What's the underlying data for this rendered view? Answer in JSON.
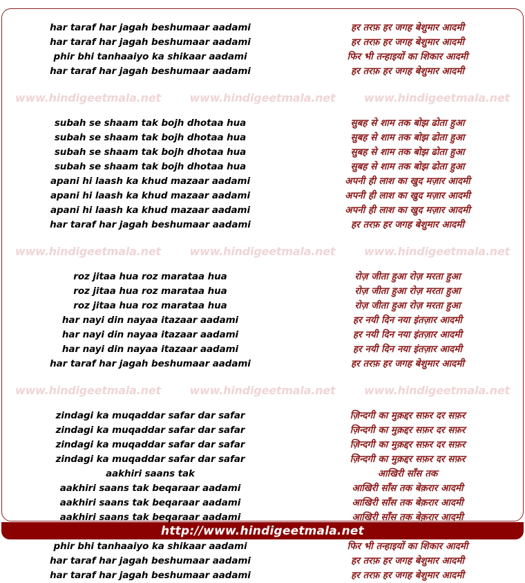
{
  "colors": {
    "latin_text": "#000000",
    "devanagari_text": "#8b1a1a",
    "watermark": "#f0d5d5",
    "footer_background": "#8b0000",
    "footer_text": "#ffffff",
    "frame_border": "#8b2020",
    "page_background": "#ffffff"
  },
  "watermark": {
    "text": "www.hindigeetmala.net",
    "repeats": 3
  },
  "footer": {
    "url": "http://www.hindigeetmala.net"
  },
  "blocks": [
    {
      "lines": [
        {
          "latin": "har taraf har jagah beshumaar aadami",
          "deva": "हर तरफ़ हर जगह बेशुमार आदमी"
        },
        {
          "latin": "har taraf har jagah beshumaar aadami",
          "deva": "हर तरफ़ हर जगह बेशुमार आदमी"
        },
        {
          "latin": "phir bhi tanhaaiyo ka shikaar aadami",
          "deva": "फिर भी तन्हाइयों का शिकार आदमी"
        },
        {
          "latin": "har taraf har jagah beshumaar aadami",
          "deva": "हर तरफ़ हर जगह बेशुमार आदमी"
        }
      ]
    },
    {
      "lines": [
        {
          "latin": "subah se shaam tak bojh dhotaa hua",
          "deva": "सुबह से शाम तक बोझ ढोता हुआ"
        },
        {
          "latin": "subah se shaam tak bojh dhotaa hua",
          "deva": "सुबह से शाम तक बोझ ढोता हुआ"
        },
        {
          "latin": "subah se shaam tak bojh dhotaa hua",
          "deva": "सुबह से शाम तक बोझ ढोता हुआ"
        },
        {
          "latin": "subah se shaam tak bojh dhotaa hua",
          "deva": "सुबह से शाम तक बोझ ढोता हुआ"
        },
        {
          "latin": "apani hi laash ka khud mazaar aadami",
          "deva": "अपनी ही लाश का खुद मज़ार आदमी"
        },
        {
          "latin": "apani hi laash ka khud mazaar aadami",
          "deva": "अपनी ही लाश का खुद मज़ार आदमी"
        },
        {
          "latin": "apani hi laash ka khud mazaar aadami",
          "deva": "अपनी ही लाश का खुद मज़ार आदमी"
        },
        {
          "latin": "har taraf har jagah beshumaar aadami",
          "deva": "हर तरफ़ हर जगह बेशुमार आदमी"
        }
      ]
    },
    {
      "lines": [
        {
          "latin": "roz jitaa hua roz marataa hua",
          "deva": "रोज़ जीता हुआ रोज़ मरता हुआ"
        },
        {
          "latin": "roz jitaa hua roz marataa hua",
          "deva": "रोज़ जीता हुआ रोज़ मरता हुआ"
        },
        {
          "latin": "roz jitaa hua roz marataa hua",
          "deva": "रोज़ जीता हुआ रोज़ मरता हुआ"
        },
        {
          "latin": "har nayi din nayaa itazaar aadami",
          "deva": "हर नयी दिन नया इंतज़ार आदमी"
        },
        {
          "latin": "har nayi din nayaa itazaar aadami",
          "deva": "हर नयी दिन नया इंतज़ार आदमी"
        },
        {
          "latin": "har nayi din nayaa itazaar aadami",
          "deva": "हर नयी दिन नया इंतज़ार आदमी"
        },
        {
          "latin": "har taraf har jagah beshumaar aadami",
          "deva": "हर तरफ़ हर जगह बेशुमार आदमी"
        }
      ]
    },
    {
      "lines": [
        {
          "latin": "zindagi ka muqaddar safar dar safar",
          "deva": "ज़िन्दगी का मुक़द्दर सफ़र दर सफ़र"
        },
        {
          "latin": "zindagi ka muqaddar safar dar safar",
          "deva": "ज़िन्दगी का मुक़द्दर सफ़र दर सफ़र"
        },
        {
          "latin": "zindagi ka muqaddar safar dar safar",
          "deva": "ज़िन्दगी का मुक़द्दर सफ़र दर सफ़र"
        },
        {
          "latin": "zindagi ka muqaddar safar dar safar",
          "deva": "ज़िन्दगी का मुक़द्दर सफ़र दर सफ़र"
        },
        {
          "latin": "aakhiri saans tak",
          "deva": "आखिरी साँस तक"
        },
        {
          "latin": "aakhiri saans tak beqaraar aadami",
          "deva": "आखिरी साँस तक बेक़रार आदमी"
        },
        {
          "latin": "aakhiri saans tak beqaraar aadami",
          "deva": "आखिरी साँस तक बेक़रार आदमी"
        },
        {
          "latin": "aakhiri saans tak beqaraar aadami",
          "deva": "आखिरी साँस तक बेक़रार आदमी"
        },
        {
          "latin": "har taraf har jagah beshumaar aadami",
          "deva": "हर तरफ़ हर जगह बेशुमार आदमी"
        },
        {
          "latin": "phir bhi tanhaaiyo ka shikaar aadami",
          "deva": "फिर भी तन्हाइयों का शिकार आदमी"
        },
        {
          "latin": "har taraf har jagah beshumaar aadami",
          "deva": "हर तरफ़ हर जगह बेशुमार आदमी"
        },
        {
          "latin": "har taraf har jagah beshumaar aadami",
          "deva": "हर तरफ़ हर जगह बेशुमार आदमी"
        }
      ]
    }
  ]
}
